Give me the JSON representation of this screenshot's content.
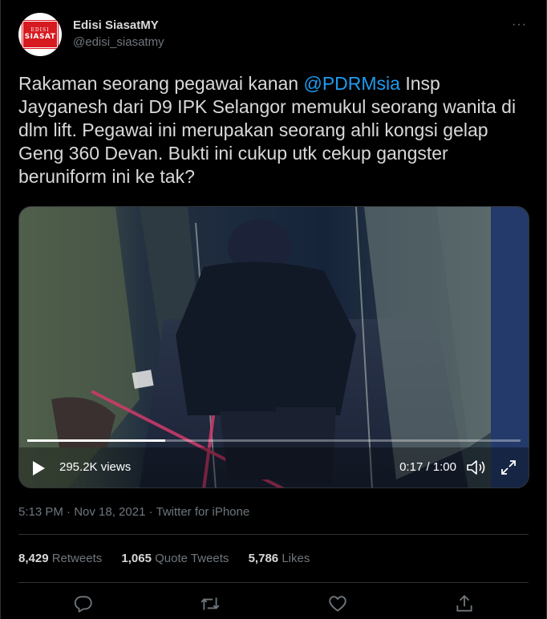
{
  "author": {
    "display_name": "Edisi SiasatMY",
    "handle": "@edisi_siasatmy",
    "avatar_text_top": "EDISI",
    "avatar_text_main": "SIASAT"
  },
  "more_label": "···",
  "tweet": {
    "text_before": "Rakaman seorang pegawai kanan ",
    "mention": "@PDRMsia",
    "text_after": " Insp Jayganesh dari D9 IPK Selangor memukul seorang wanita di dlm lift. Pegawai ini merupakan seorang ahli kongsi gelap Geng 360 Devan. Bukti ini cukup utk cekup gangster beruniform ini ke tak?"
  },
  "video": {
    "views": "295.2K views",
    "time": "0:17 / 1:00",
    "progress": 0.28
  },
  "meta": {
    "timestamp": "5:13 PM · Nov 18, 2021 · Twitter for iPhone"
  },
  "stats": {
    "retweets_count": "8,429",
    "retweets_label": "Retweets",
    "quotes_count": "1,065",
    "quotes_label": "Quote Tweets",
    "likes_count": "5,786",
    "likes_label": "Likes"
  },
  "colors": {
    "background": "#000000",
    "accent": "#1d9bf0",
    "secondary_text": "#6e767d",
    "border": "#2f3336",
    "brand_red": "#d71920"
  },
  "icons": {
    "reply": "reply-icon",
    "retweet": "retweet-icon",
    "like": "heart-icon",
    "share": "share-icon",
    "play": "play-icon",
    "volume": "volume-icon",
    "fullscreen": "fullscreen-icon"
  }
}
